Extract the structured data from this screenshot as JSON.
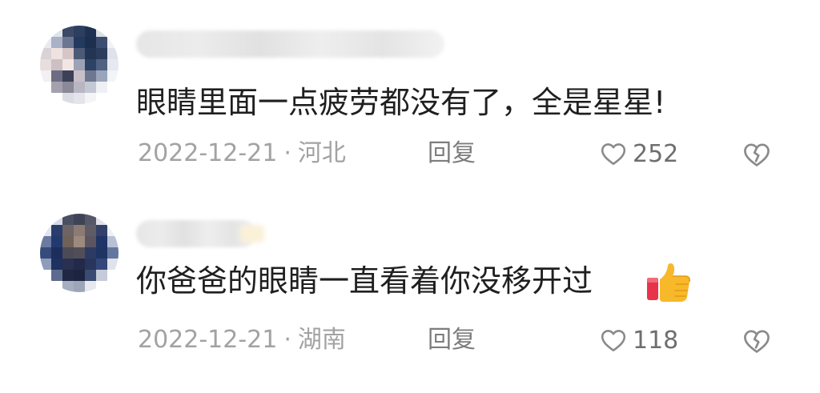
{
  "colors": {
    "text_primary": "#1f1f1f",
    "text_secondary": "#a2a2a2",
    "icon_gray": "#8a8a8a"
  },
  "comments": [
    {
      "text": "眼睛里面一点疲劳都没有了，全是星星!",
      "date": "2022-12-21",
      "separator": "·",
      "location": "河北",
      "reply_label": "回复",
      "like_count": "252"
    },
    {
      "text": "你爸爸的眼睛一直看着你没移开过",
      "emoji": "thumbs-up-icon",
      "date": "2022-12-21",
      "separator": "·",
      "location": "湖南",
      "reply_label": "回复",
      "like_count": "118"
    }
  ]
}
